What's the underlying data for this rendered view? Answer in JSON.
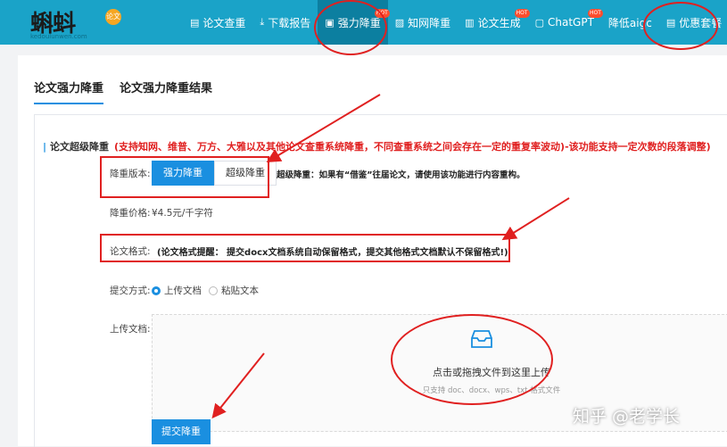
{
  "logo": {
    "text": "蝌蚪",
    "sub": "kedoulunwen.com",
    "badge": "论文"
  },
  "nav": {
    "items": [
      {
        "label": "论文查重",
        "icon": "document-icon",
        "hot": false,
        "active": false
      },
      {
        "label": "下载报告",
        "icon": "download-icon",
        "hot": false,
        "active": false
      },
      {
        "label": "强力降重",
        "icon": "edit-icon",
        "hot": true,
        "active": true
      },
      {
        "label": "知网降重",
        "icon": "image-icon",
        "hot": false,
        "active": false
      },
      {
        "label": "论文生成",
        "icon": "file-icon",
        "hot": true,
        "active": false
      },
      {
        "label": "ChatGPT",
        "icon": "chat-icon",
        "hot": true,
        "active": false
      },
      {
        "label": "降低aigc",
        "icon": "",
        "hot": false,
        "active": false
      },
      {
        "label": "优惠套餐",
        "icon": "tag-icon",
        "hot": false,
        "active": false
      }
    ],
    "hot_label": "HOT"
  },
  "tabs": [
    "论文强力降重",
    "论文强力降重结果"
  ],
  "section": {
    "title": "论文超级降重",
    "note": "(支持知网、维普、万方、大雅以及其他论文查重系统降重，不同查重系统之间会存在一定的重复率波动)-该功能支持一定次数的段落调整)"
  },
  "mode": {
    "label": "降重版本:",
    "options": [
      "强力降重",
      "超级降重"
    ],
    "selected": "强力降重",
    "hint": "超级降重：如果有“借鉴”往届论文，请使用该功能进行内容重构。"
  },
  "price": {
    "label": "降重价格:",
    "value": "¥4.5元/千字符"
  },
  "format": {
    "label": "论文格式:",
    "text": "(论文格式提醒： 提交docx文档系统自动保留格式，提交其他格式文档默认不保留格式!)"
  },
  "submit_method": {
    "label": "提交方式:",
    "options": [
      "上传文档",
      "粘贴文本"
    ],
    "selected": "上传文档"
  },
  "upload": {
    "label": "上传文档:",
    "main": "点击或拖拽文件到这里上传",
    "sub": "只支持 doc、docx、wps、txt 格式文件",
    "icon": "inbox-icon"
  },
  "submit_button": "提交降重",
  "watermark": "知乎 @老学长",
  "colors": {
    "nav": "#1aa3c8",
    "primary": "#1a8fe0",
    "annotation": "#e02020"
  }
}
